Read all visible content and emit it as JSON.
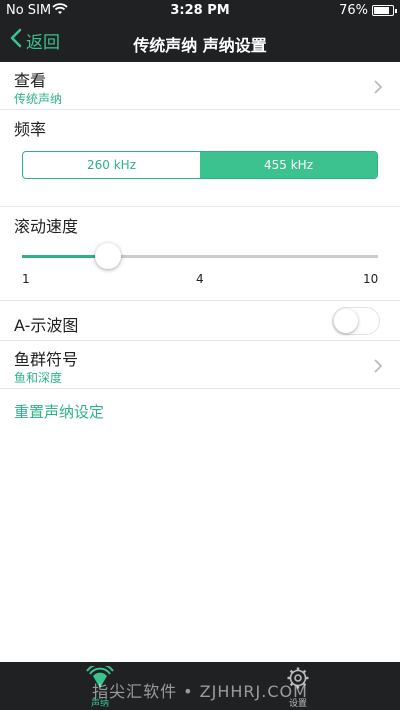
{
  "status_bar": {
    "carrier": "No SIM",
    "time": "3:28 PM",
    "battery": "76%"
  },
  "nav": {
    "back_label": "返回",
    "title": "传统声纳 声纳设置"
  },
  "view_row": {
    "label": "查看",
    "value": "传统声纳"
  },
  "frequency": {
    "label": "频率",
    "options": [
      "260 kHz",
      "455 kHz"
    ],
    "selected": "455 kHz"
  },
  "scroll_speed": {
    "label": "滚动速度",
    "min_label": "1",
    "mid_label": "4",
    "max_label": "10",
    "value": 3,
    "min": 1,
    "max": 10
  },
  "a_scope": {
    "label": "A-示波图",
    "enabled": false
  },
  "fish_symbol": {
    "label": "鱼群符号",
    "value": "鱼和深度"
  },
  "reset_label": "重置声纳设定",
  "tabs": [
    {
      "label": "声纳",
      "icon": "sonar-icon",
      "active": true
    },
    {
      "label": "设置",
      "icon": "gear-icon",
      "active": false
    }
  ],
  "watermark": "指尖汇软件 • ZJHHRJ.COM",
  "colors": {
    "accent": "#3cc28f",
    "accent_text": "#2db383",
    "bar_bg": "#1f2123"
  }
}
